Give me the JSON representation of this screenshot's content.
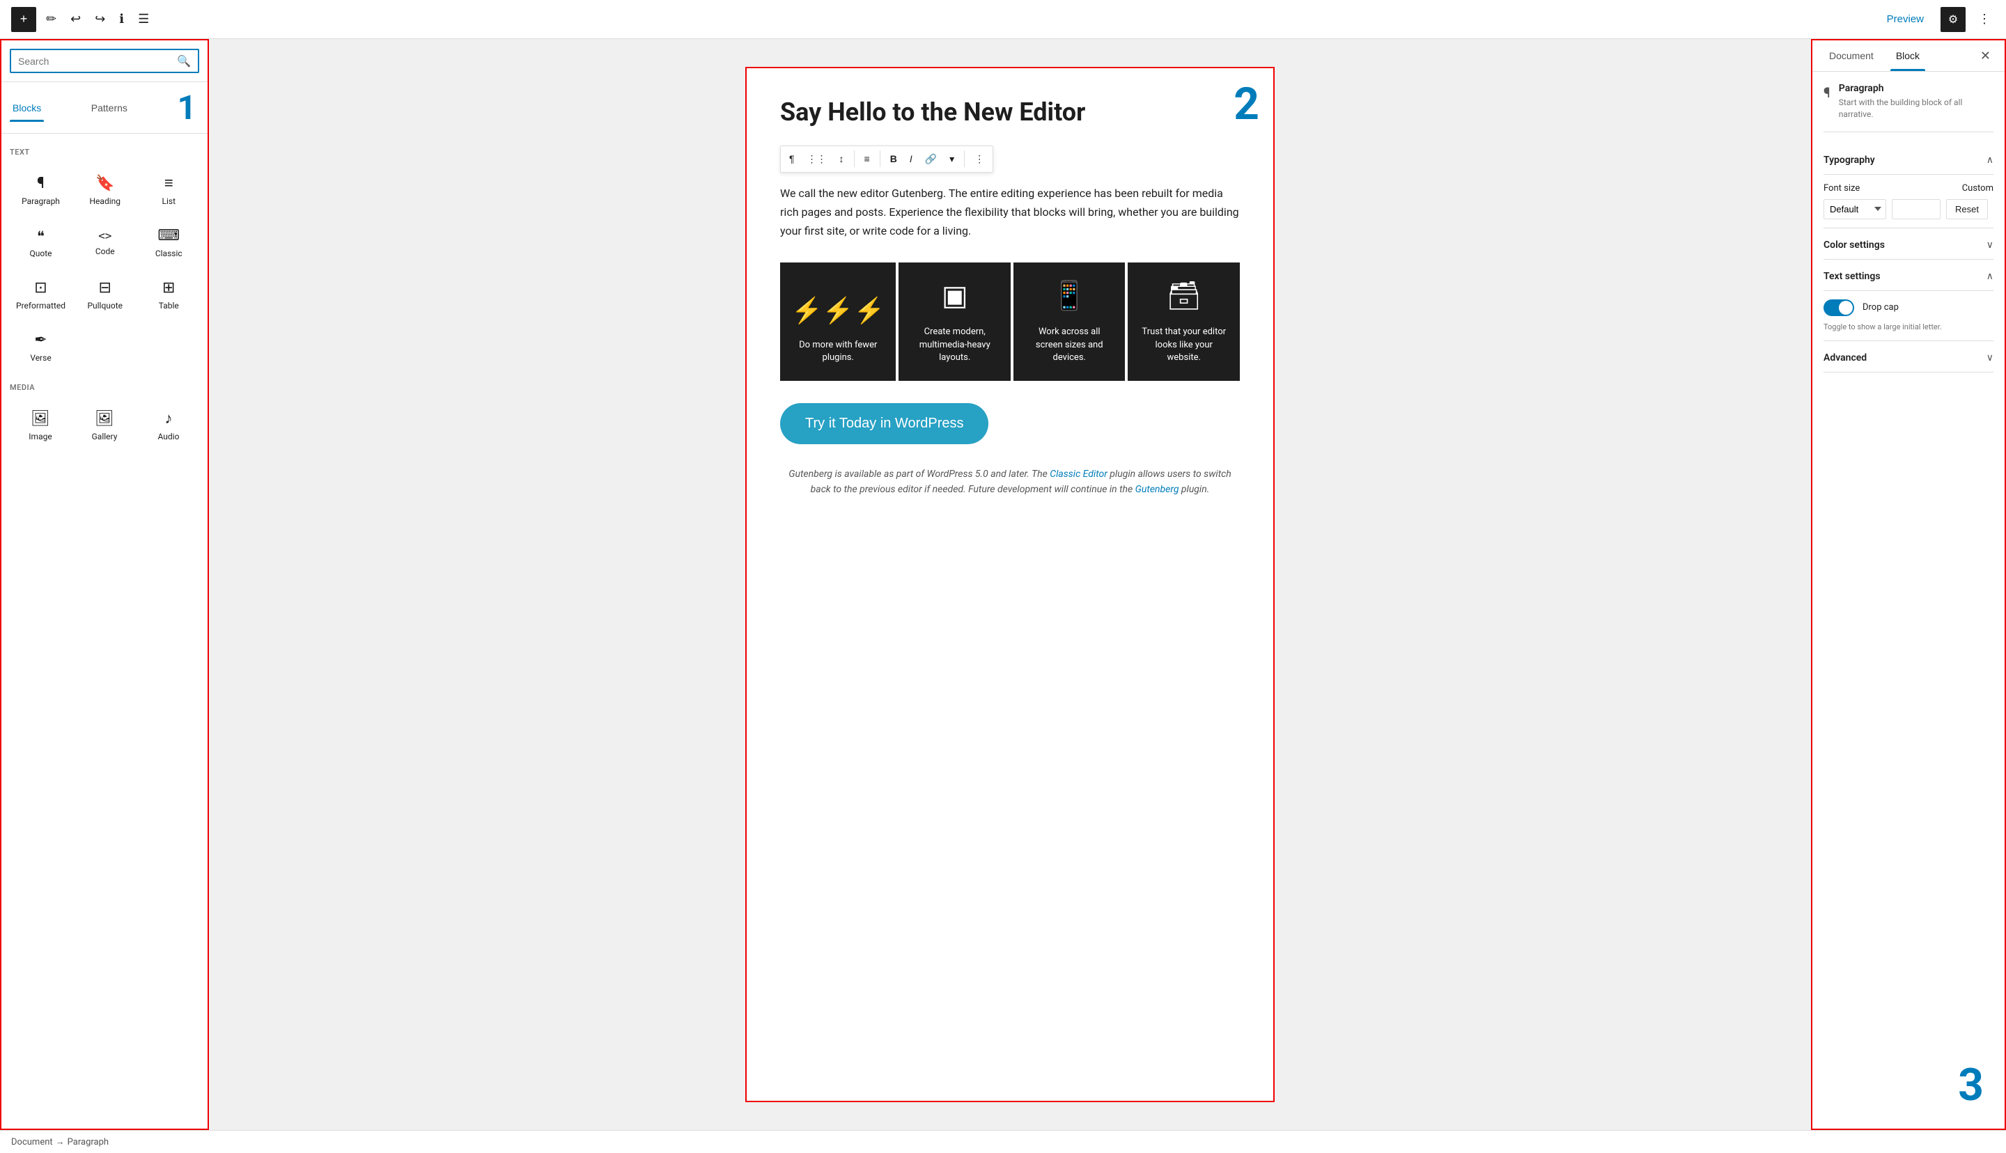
{
  "toolbar": {
    "plus_label": "+",
    "preview_label": "Preview",
    "settings_label": "⚙",
    "more_label": "⋮"
  },
  "left_sidebar": {
    "search_placeholder": "Search",
    "tabs": [
      {
        "label": "Blocks",
        "active": true
      },
      {
        "label": "Patterns",
        "active": false
      }
    ],
    "number": "1",
    "sections": [
      {
        "label": "TEXT",
        "blocks": [
          {
            "icon": "¶",
            "label": "Paragraph"
          },
          {
            "icon": "🔖",
            "label": "Heading"
          },
          {
            "icon": "≡",
            "label": "List"
          },
          {
            "icon": "❝",
            "label": "Quote"
          },
          {
            "icon": "<>",
            "label": "Code"
          },
          {
            "icon": "⌨",
            "label": "Classic"
          },
          {
            "icon": "⊡",
            "label": "Preformatted"
          },
          {
            "icon": "⊟",
            "label": "Pullquote"
          },
          {
            "icon": "⊞",
            "label": "Table"
          },
          {
            "icon": "✒",
            "label": "Verse"
          }
        ]
      },
      {
        "label": "MEDIA",
        "blocks": [
          {
            "icon": "🖼",
            "label": "Image"
          },
          {
            "icon": "🖼",
            "label": "Gallery"
          },
          {
            "icon": "♪",
            "label": "Audio"
          }
        ]
      }
    ]
  },
  "editor": {
    "number": "2",
    "title": "Say Hello to the New Editor",
    "toolbar_buttons": [
      "¶",
      "⋮⋮",
      "↕",
      "≡",
      "B",
      "I",
      "🔗",
      "▾",
      "⋮"
    ],
    "body_text": "We call the new editor Gutenberg. The entire editing experience has been rebuilt for media rich pages and posts. Experience the flexibility that blocks will bring, whether you are building your first site, or write code for a living.",
    "feature_cards": [
      {
        "icon": "⚡⚡⚡",
        "text": "Do more with fewer plugins."
      },
      {
        "icon": "▣",
        "text": "Create modern, multimedia-heavy layouts."
      },
      {
        "icon": "📱",
        "text": "Work across all screen sizes and devices."
      },
      {
        "icon": "🗃",
        "text": "Trust that your editor looks like your website."
      }
    ],
    "cta_button": "Try it Today in WordPress",
    "footer_text_before": "Gutenberg is available as part of WordPress 5.0 and later. The ",
    "footer_link1_text": "Classic Editor",
    "footer_text_mid": " plugin allows users to switch back to the previous editor if needed. Future development will continue in the ",
    "footer_link2_text": "Gutenberg",
    "footer_text_after": " plugin."
  },
  "right_sidebar": {
    "tabs": [
      {
        "label": "Document",
        "active": false
      },
      {
        "label": "Block",
        "active": true
      }
    ],
    "number": "3",
    "block_info": {
      "icon": "¶",
      "title": "Paragraph",
      "description": "Start with the building block of all narrative."
    },
    "sections": [
      {
        "label": "Typography",
        "expanded": true,
        "font_size_label": "Font size",
        "custom_label": "Custom",
        "font_size_default": "Default",
        "reset_label": "Reset"
      },
      {
        "label": "Color settings",
        "expanded": false
      },
      {
        "label": "Text settings",
        "expanded": true,
        "drop_cap_label": "Drop cap",
        "drop_cap_hint": "Toggle to show a large initial letter.",
        "drop_cap_enabled": true
      },
      {
        "label": "Advanced",
        "expanded": false
      }
    ]
  },
  "bottom_status": {
    "document_label": "Document",
    "arrow": "→",
    "paragraph_label": "Paragraph"
  }
}
